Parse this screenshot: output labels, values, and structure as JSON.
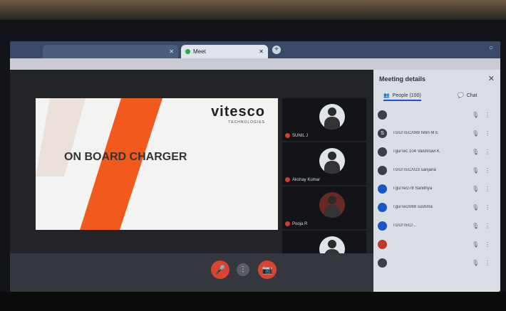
{
  "browser": {
    "tabs": [
      {
        "label": "",
        "active": false
      },
      {
        "label": "Meet",
        "active": true
      }
    ],
    "new_tab": "+",
    "window_controls": "○",
    "url": ""
  },
  "slide": {
    "brand": "vitesco",
    "brand_sub": "TECHNOLOGIES",
    "title": "ON BOARD CHARGER"
  },
  "participants_tiles": [
    {
      "label": "SUNIL J"
    },
    {
      "label": "Akshay Kumar"
    },
    {
      "label": "Pooja R"
    },
    {
      "label": ""
    }
  ],
  "controls": {
    "mic": "🎤",
    "more": "⋮",
    "camera": "📷"
  },
  "panel": {
    "title": "Meeting details",
    "close": "✕",
    "tabs": {
      "people": "People (100)",
      "chat": "Chat"
    },
    "people": [
      {
        "initial": "",
        "name": ""
      },
      {
        "initial": "S",
        "name": "TGU/TEC/069 Nitin M E"
      },
      {
        "initial": "",
        "name": "Tgu/Tec 104 Vaishnavi K"
      },
      {
        "initial": "",
        "name": "TGU/TEC/023 sanjana"
      },
      {
        "initial": "",
        "name": "Tgu/Tec/78 Sandhya"
      },
      {
        "initial": "",
        "name": "Tgu/Tec/069 sushma"
      },
      {
        "initial": "",
        "name": "TGU/TEC/..."
      },
      {
        "initial": "",
        "name": ""
      },
      {
        "initial": "",
        "name": ""
      }
    ]
  },
  "colors": {
    "accent": "#1a55c7",
    "end_call": "#d9432f",
    "slide_orange": "#f25a1d"
  }
}
